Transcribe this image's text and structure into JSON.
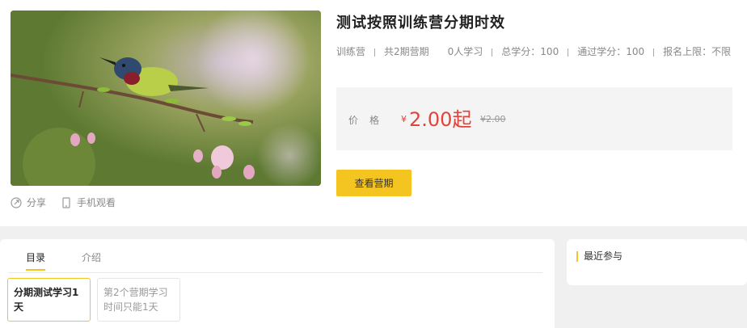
{
  "course": {
    "title": "测试按照训练营分期时效",
    "meta": [
      "训练营",
      "共2期营期",
      "0人学习",
      "总学分：100",
      "通过学分：100",
      "报名上限：不限"
    ]
  },
  "price": {
    "label": "价格",
    "currency": "¥",
    "value": "2.00起",
    "original": "¥2.00"
  },
  "actions": {
    "share": "分享",
    "mobile": "手机观看"
  },
  "button": {
    "view_periods": "查看营期"
  },
  "tabs": [
    "目录",
    "介绍"
  ],
  "periods": [
    "分期测试学习1天",
    "第2个营期学习时间只能1天"
  ],
  "sidebar": {
    "title": "最近参与"
  },
  "colors": {
    "accent": "#f4c420",
    "price": "#e0443a"
  },
  "icons": [
    "share-icon",
    "mobile-icon"
  ]
}
